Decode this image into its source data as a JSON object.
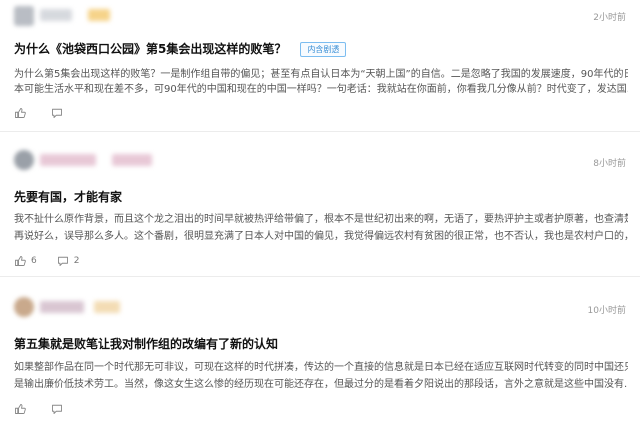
{
  "posts": [
    {
      "time": "2小时前",
      "title": "为什么《池袋西口公园》第5集会出现这样的败笔？",
      "tag": "内含剧透",
      "lines": [
        "为什么第5集会出现这样的败笔？一是制作组自带的偏见；甚至有点自认日本为“天朝上国”的自信。二是忽略了我国的发展速度，90年代的日",
        "本可能生活水平和现在差不多，可90年代的中国和现在的中国一样吗？一句老话：我就站在你面前，你看我几分像从前？时代变了，发达国..."
      ],
      "like_count": "",
      "comment_count": ""
    },
    {
      "time": "8小时前",
      "title": "先要有国，才能有家",
      "tag": "",
      "lines": [
        "我不扯什么原作背景，而且这个龙之泪出的时间早就被热评给带偏了，根本不是世纪初出来的啊，无语了，要热评护主或者护原著，也查清楚",
        "再说好么，误导那么多人。这个番剧，很明显充满了日本人对中国的偏见，我觉得偏远农村有贫困的很正常，也不否认，我也是农村户口的，..."
      ],
      "like_count": "6",
      "comment_count": "2"
    },
    {
      "time": "10小时前",
      "title": "第五集就是败笔让我对制作组的改编有了新的认知",
      "tag": "",
      "lines": [
        "如果整部作品在同一个时代那无可非议，可现在这样的时代拼凑，传达的一个直接的信息就是日本已经在适应互联网时代转变的同时中国还只",
        "是输出廉价低技术劳工。当然，像这女生这么惨的经历现在可能还存在，但最过分的是看着夕阳说出的那段话，言外之意就是这些中国没有..."
      ],
      "like_count": "",
      "comment_count": ""
    }
  ]
}
